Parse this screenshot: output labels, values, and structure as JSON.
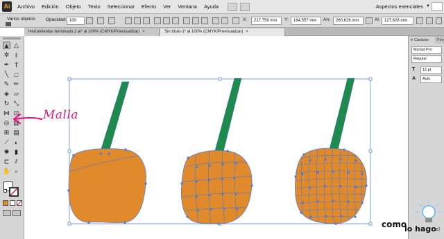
{
  "menubar": {
    "app_logo": "Ai",
    "items": [
      "Archivo",
      "Edición",
      "Objeto",
      "Texto",
      "Seleccionar",
      "Efecto",
      "Ver",
      "Ventana",
      "Ayuda"
    ],
    "workspace": "Aspectos esenciales"
  },
  "controlbar": {
    "selection_label": "Varios objetos",
    "opacity_label": "Opacidad:",
    "opacity_value": "100",
    "x_label": "X:",
    "x_value": "217,759 mm",
    "y_label": "Y:",
    "y_value": "184,557 mm",
    "w_label": "An:",
    "w_value": "260,626 mm",
    "h_label": "Al:",
    "h_value": "127,628 mm"
  },
  "tabs": [
    {
      "label": "Herramientas terminado 2.ai* al 100% (CMYK/Previsualizar)",
      "close": "×"
    },
    {
      "label": "Sin título-1* al 100% (CMYK/Previsualizar)",
      "close": "×"
    }
  ],
  "panel": {
    "tab_active": "≎ Carácter",
    "tab_inactive": "Párrafo",
    "font_family": "Myriad Pro",
    "font_style": "Regular",
    "font_size": "12 pt",
    "leading": "Auto"
  },
  "annotation": {
    "label": "Malla"
  },
  "brand": {
    "line1": "como",
    "line2": "lo hago",
    "suffix": ".cl"
  },
  "colors": {
    "cherry_fill": "#e08a2c",
    "stem": "#1e8a4c",
    "selection_blue": "#4a78d8",
    "annotation": "#e0197d"
  }
}
